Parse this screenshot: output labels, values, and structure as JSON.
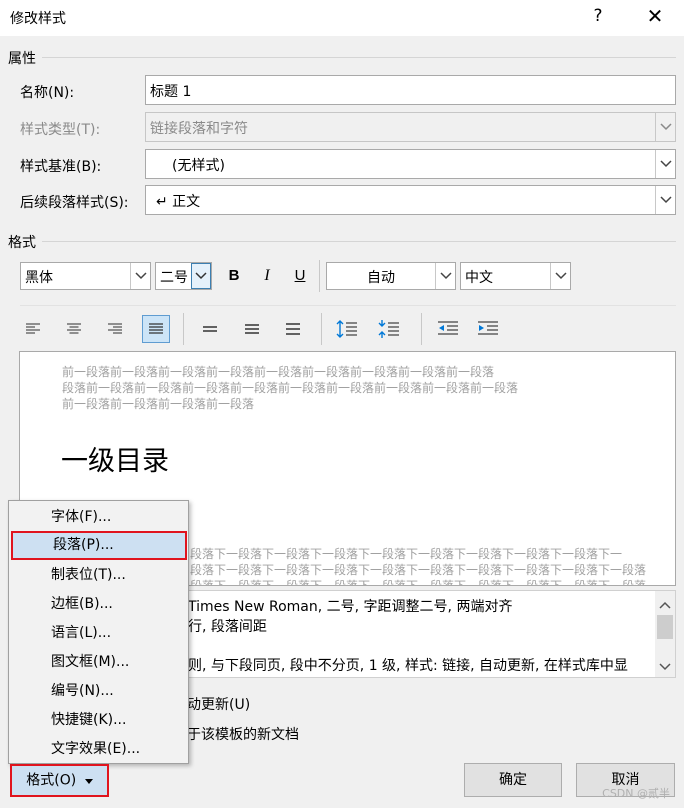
{
  "window": {
    "title": "修改样式",
    "help_glyph": "?",
    "close_glyph": "✕"
  },
  "properties": {
    "group_label": "属性",
    "name_label": "名称(N):",
    "name_value": "标题 1",
    "style_type_label": "样式类型(T):",
    "style_type_value": "链接段落和字符",
    "based_on_label": "样式基准(B):",
    "based_on_value": "(无样式)",
    "following_label": "后续段落样式(S):",
    "following_value": "↵ 正文"
  },
  "format": {
    "group_label": "格式",
    "font": "黑体",
    "size": "二号",
    "bold": "B",
    "italic": "I",
    "underline": "U",
    "color": "自动",
    "script": "中文"
  },
  "preview": {
    "prev_para": [
      "前一段落前一段落前一段落前一段落前一段落前一段落前一段落前一段落前一段落",
      "段落前一段落前一段落前一段落前一段落前一段落前一段落前一段落前一段落前一段落",
      "前一段落前一段落前一段落前一段落"
    ],
    "heading": "一级目录",
    "next_para": [
      "段落下一段落下一段落下一段落下一段落下一段落下一段落下一段落下一段落下一",
      "段落下一段落下一段落下一段落下一段落下一段落下一段落下一段落下一段落下一段落",
      "段落下一段落下一段落下一段落下一段落下一段落下一段落下一段落下一段落下一段落"
    ]
  },
  "description": {
    "line1": "Times New Roman, 二号, 字距调整二号, 两端对齐",
    "line2": "行, 段落间距",
    "line3": "则, 与下段同页, 段中不分页, 1 级, 样式: 链接, 自动更新, 在样式库中显"
  },
  "options": {
    "auto_update": "动更新(U)",
    "new_docs": "于该模板的新文档"
  },
  "menu": {
    "items": [
      "字体(F)...",
      "段落(P)...",
      "制表位(T)...",
      "边框(B)...",
      "语言(L)...",
      "图文框(M)...",
      "编号(N)...",
      "快捷键(K)...",
      "文字效果(E)..."
    ]
  },
  "buttons": {
    "format": "格式(O)",
    "ok": "确定",
    "cancel": "取消"
  },
  "watermark": "CSDN @贰半",
  "colors": {
    "highlight": "#cde0f2",
    "callout_border": "#e0141e",
    "accent": "#0078d7"
  }
}
